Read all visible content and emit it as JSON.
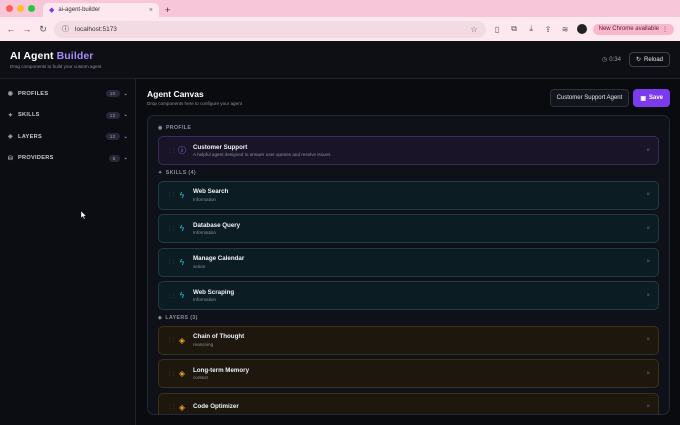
{
  "browser": {
    "tab_title": "ai-agent-builder",
    "url": "localhost:5173",
    "update_label": "New Chrome available",
    "colors": {
      "tabbar": "#f7c6d9",
      "addrbar": "#fde8f0"
    }
  },
  "header": {
    "title_main": "AI Agent",
    "title_accent": "Builder",
    "subtitle": "Drag components to build your custom agent",
    "timer": "0:34",
    "reload_label": "Reload"
  },
  "sidebar": {
    "items": [
      {
        "label": "PROFILES",
        "count": "10",
        "icon": "user-icon"
      },
      {
        "label": "SKILLS",
        "count": "12",
        "icon": "skills-icon"
      },
      {
        "label": "LAYERS",
        "count": "12",
        "icon": "layers-icon"
      },
      {
        "label": "PROVIDERS",
        "count": "5",
        "icon": "providers-icon"
      }
    ]
  },
  "canvas": {
    "title": "Agent Canvas",
    "subtitle": "Drop components here to configure your agent",
    "agent_name": "Customer Support Agent",
    "save_label": "Save",
    "sections": {
      "profile": "PROFILE",
      "skills": "SKILLS (4)",
      "layers": "LAYERS (3)"
    },
    "profile": {
      "title": "Customer Support",
      "subtitle": "A helpful agent designed to answer user queries and resolve issues"
    },
    "skills": [
      {
        "title": "Web Search",
        "subtitle": "Information"
      },
      {
        "title": "Database Query",
        "subtitle": "Information"
      },
      {
        "title": "Manage Calendar",
        "subtitle": "action"
      },
      {
        "title": "Web Scraping",
        "subtitle": "Information"
      }
    ],
    "layers": [
      {
        "title": "Chain of Thought",
        "subtitle": "reasoning"
      },
      {
        "title": "Long-term Memory",
        "subtitle": "context"
      },
      {
        "title": "Code Optimizer",
        "subtitle": ""
      }
    ],
    "colors": {
      "profile": "#a78bfa",
      "skill": "#22d3ee",
      "layer": "#f5a524",
      "save": "#7c3aed"
    }
  }
}
